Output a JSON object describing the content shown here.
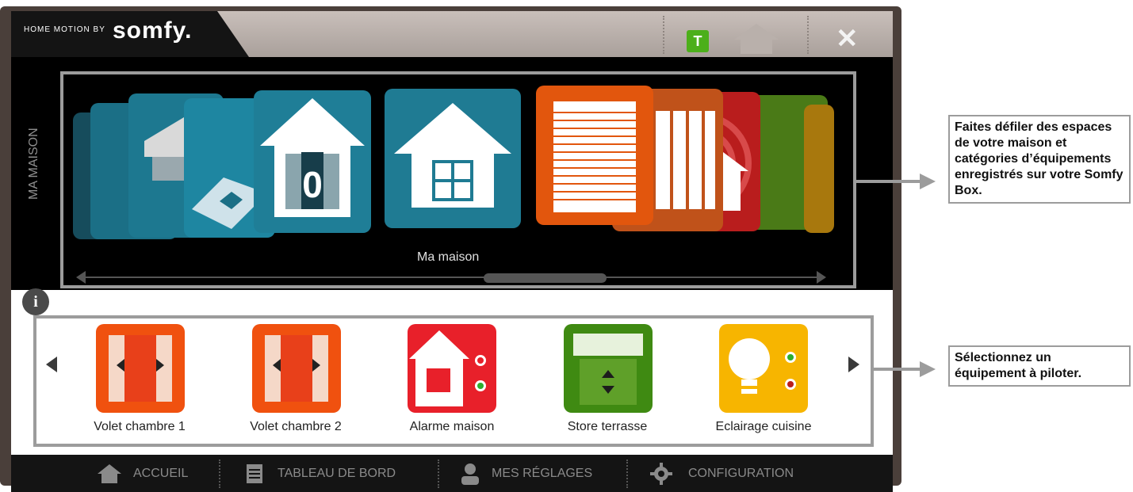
{
  "title_bar": {
    "brand_prefix": "HOME MOTION BY",
    "brand_logo": "somfy.",
    "tahoma_badge": "T",
    "home_icon": "house-icon",
    "close_icon": "close-icon"
  },
  "carousel": {
    "vertical_label": "MA MAISON",
    "selected_caption": "Ma maison",
    "tiles": [
      {
        "icon": "garage-icon",
        "color": "#1b6f86"
      },
      {
        "icon": "room-icon",
        "color": "#1b6f86"
      },
      {
        "icon": "awning-icon",
        "color": "#1b6f86"
      },
      {
        "icon": "laptop-icon",
        "color": "#1b6f86"
      },
      {
        "icon": "house-floor-0-icon",
        "color": "#1b6f86"
      },
      {
        "icon": "house-window-icon",
        "color": "#1f7b93"
      },
      {
        "icon": "blind-icon",
        "color": "#e2560d"
      },
      {
        "icon": "shutter-icon",
        "color": "#b84514"
      },
      {
        "icon": "alarm-icon",
        "color": "#b91d1d"
      },
      {
        "icon": "store-icon",
        "color": "#4a7a17"
      }
    ]
  },
  "devices": [
    {
      "label": "Volet chambre 1",
      "icon": "shutter-icon",
      "color": "#f0510f"
    },
    {
      "label": "Volet chambre 2",
      "icon": "shutter-icon",
      "color": "#f0510f"
    },
    {
      "label": "Alarme maison",
      "icon": "alarm-icon",
      "color": "#e8202a"
    },
    {
      "label": "Store terrasse",
      "icon": "awning-icon",
      "color": "#3f8a12"
    },
    {
      "label": "Eclairage cuisine",
      "icon": "bulb-icon",
      "color": "#f7b500"
    }
  ],
  "info_icon": "i",
  "bottom_nav": [
    {
      "label": "ACCUEIL",
      "icon": "home-icon"
    },
    {
      "label": "TABLEAU DE BORD",
      "icon": "dashboard-icon"
    },
    {
      "label": "MES RÉGLAGES",
      "icon": "user-icon"
    },
    {
      "label": "CONFIGURATION",
      "icon": "gear-icon"
    }
  ],
  "callouts": {
    "top": "Faites défiler des espaces de votre maison et catégories d’équipements enregistrés sur votre Somfy Box.",
    "bottom": "Sélectionnez un équipement à piloter."
  }
}
